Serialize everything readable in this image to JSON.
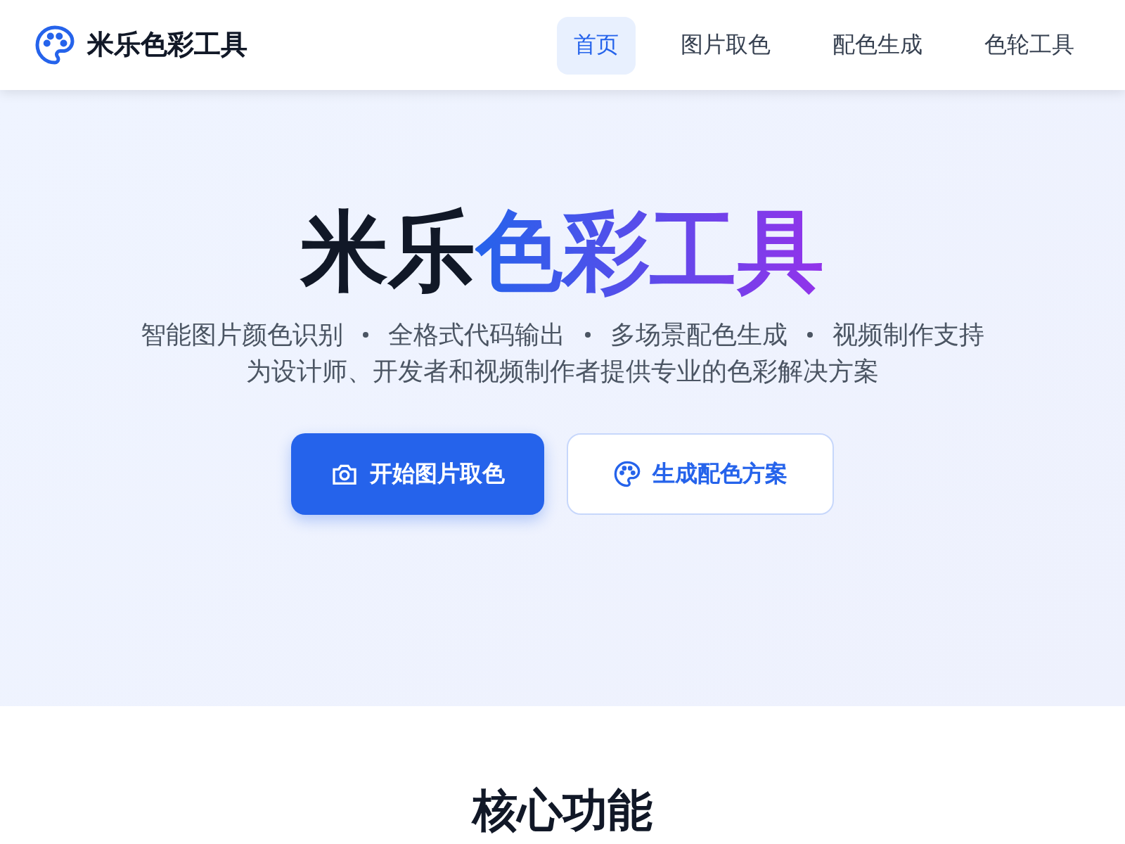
{
  "header": {
    "logo_text": "米乐色彩工具"
  },
  "nav": [
    {
      "label": "首页",
      "selected": true
    },
    {
      "label": "图片取色",
      "selected": false
    },
    {
      "label": "配色生成",
      "selected": false
    },
    {
      "label": "色轮工具",
      "selected": false
    }
  ],
  "hero": {
    "title_plain": "米乐",
    "title_highlight": "色彩工具",
    "features": [
      "智能图片颜色识别",
      "全格式代码输出",
      "多场景配色生成",
      "视频制作支持"
    ],
    "tagline": "为设计师、开发者和视频制作者提供专业的色彩解决方案",
    "buttons": [
      {
        "label": "开始图片取色",
        "kind": "primary"
      },
      {
        "label": "生成配色方案",
        "kind": "secondary"
      }
    ]
  },
  "section": {
    "title": "核心功能"
  }
}
